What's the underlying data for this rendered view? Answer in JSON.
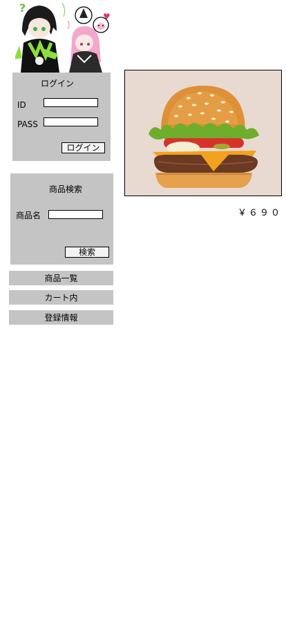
{
  "illustration": {
    "icon": "anime-characters-illustration",
    "marks": [
      "?",
      "♥"
    ]
  },
  "login": {
    "title": "ログイン",
    "id_label": "ID",
    "pass_label": "PASS",
    "id_value": "",
    "pass_value": "",
    "submit_label": "ログイン"
  },
  "search": {
    "title": "商品検索",
    "name_label": "商品名",
    "name_value": "",
    "submit_label": "検索"
  },
  "nav": {
    "items": [
      {
        "label": "商品一覧"
      },
      {
        "label": "カート内"
      },
      {
        "label": "登録情報"
      }
    ]
  },
  "product": {
    "image_icon": "hamburger-photo",
    "price": "￥６９０"
  },
  "colors": {
    "panel": "#c4c4c4",
    "image_background": "#e8d9d1",
    "cheese": "#f2a21f",
    "lettuce": "#6fae2c",
    "tomato": "#d8332a",
    "bun": "#e6a14c"
  }
}
